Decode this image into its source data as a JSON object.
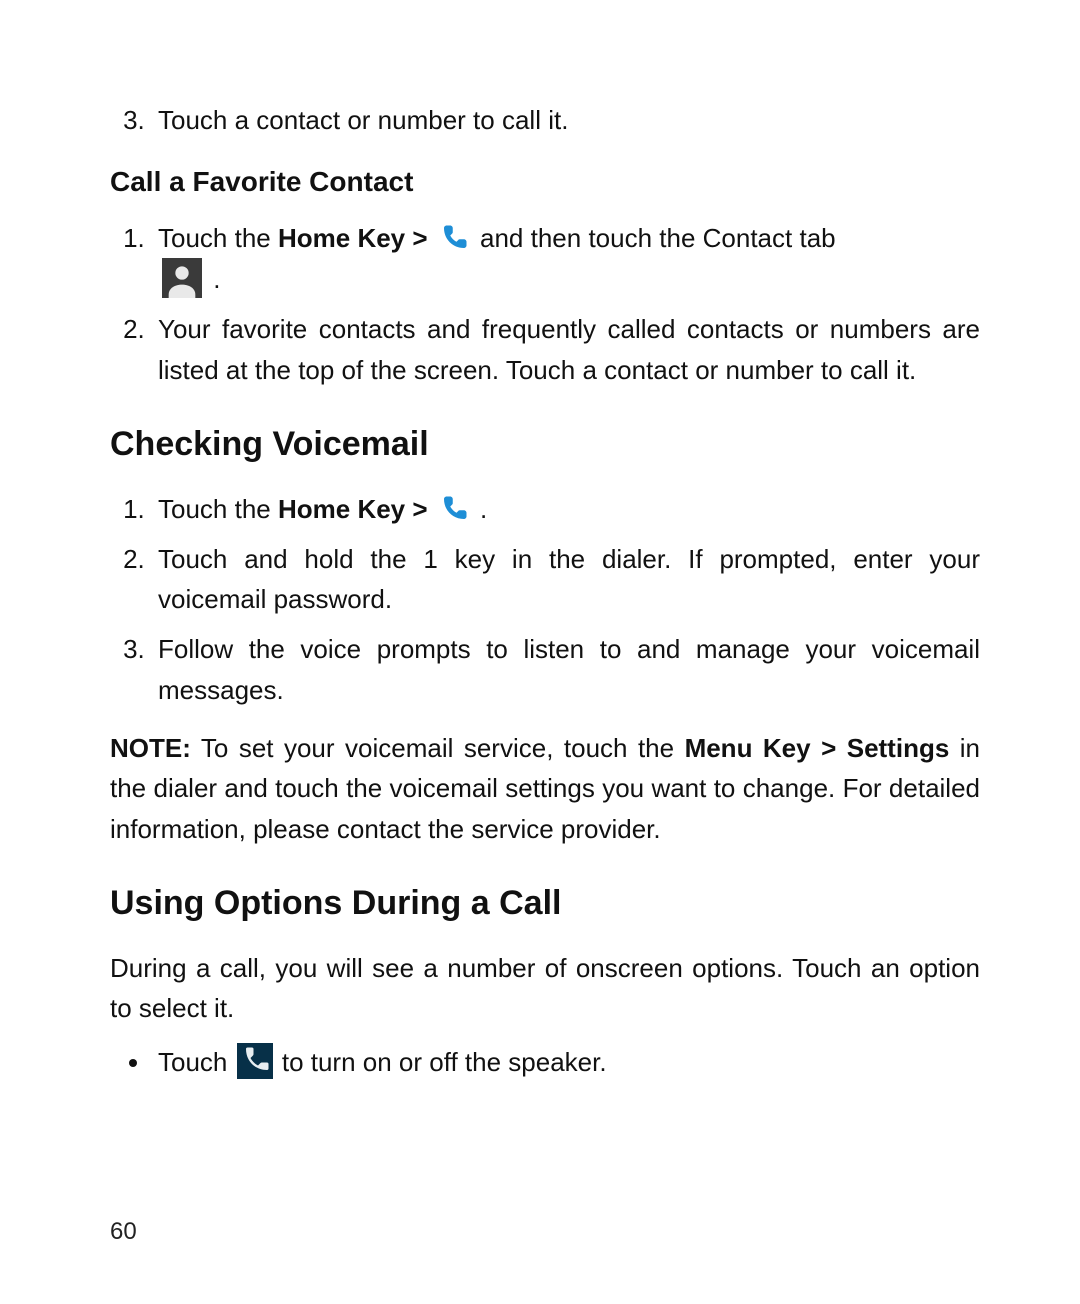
{
  "page_number": "60",
  "top_list_start": 3,
  "top_list": {
    "item3": "Touch a contact or number to call it."
  },
  "favorite": {
    "heading": "Call a Favorite Contact",
    "step1_a": "Touch the ",
    "step1_b_bold": "Home Key > ",
    "step1_c": " and then touch the Contact tab ",
    "step1_d": " .",
    "step2": "Your favorite contacts and frequently called contacts or numbers are listed at the top of the screen. Touch a contact or number to call it."
  },
  "voicemail": {
    "heading": "Checking Voicemail",
    "step1_a": "Touch the ",
    "step1_b_bold": "Home Key > ",
    "step1_c": " .",
    "step2": "Touch and hold the 1 key in the dialer. If prompted, enter your voicemail password.",
    "step3": "Follow the voice prompts to listen to and manage your voicemail messages.",
    "note_label": "NOTE:",
    "note_a": " To set your voicemail service, touch the ",
    "note_bold1": "Menu Key > Settings",
    "note_b": " in the dialer and touch the voicemail settings you want to change. For detailed information, please contact the service provider."
  },
  "during_call": {
    "heading": "Using Options During a Call",
    "intro": "During a call, you will see a number of onscreen options. Touch an option to select it.",
    "bullet1_a": "Touch ",
    "bullet1_b": " to turn on or off the speaker."
  }
}
